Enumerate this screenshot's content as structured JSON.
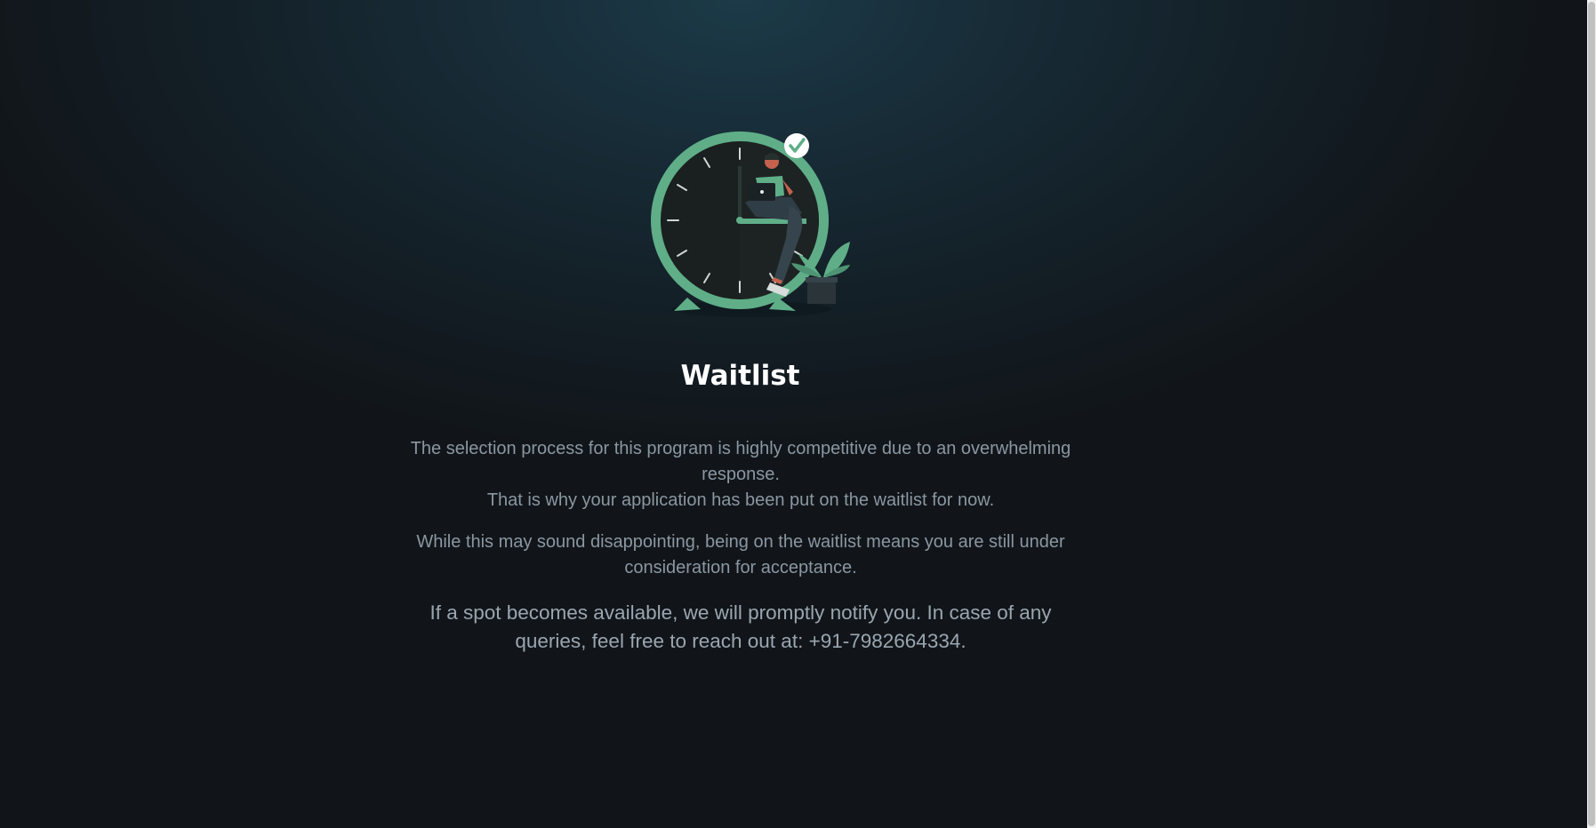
{
  "page": {
    "title": "Waitlist"
  },
  "illustration": {
    "icon": "clock-waitlist-illustration",
    "accent_color": "#5fae88",
    "check_badge_icon": "check-icon"
  },
  "message": {
    "line1": "The selection process for this program is highly competitive due to an overwhelming response.",
    "line2": "That is why your application has been put on the waitlist for now.",
    "line3": "While this may sound disappointing, being on the waitlist means you are still under consideration for acceptance.",
    "line4": "If a spot becomes available, we will promptly notify you. In case of any queries, feel free to reach out at: +91-7982664334."
  }
}
